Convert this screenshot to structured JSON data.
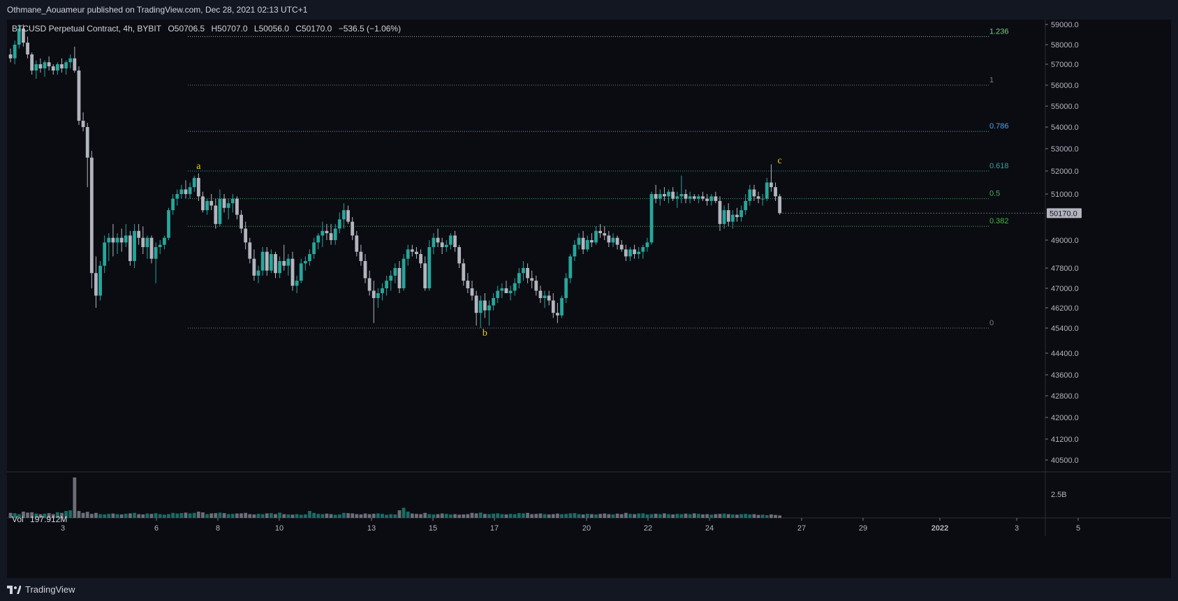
{
  "header": {
    "published": "Othmane_Aouameur published on TradingView.com, Dec 28, 2021 02:13 UTC+1"
  },
  "symbol": {
    "name": "BTCUSD Perpetual Contract, 4h, BYBIT",
    "open": "O50706.5",
    "high": "H50707.0",
    "low": "L50056.0",
    "close": "C50170.0",
    "change": "−536.5 (−1.06%)"
  },
  "volume_panel": {
    "label": "Vol",
    "value": "197.912M",
    "axis_label": "2.5B"
  },
  "footer": {
    "brand": "TradingView"
  },
  "colors": {
    "background": "#0b0c12",
    "up_candle": "#26a69a",
    "down_candle": "#b2b5be",
    "wave_label": "#f5d400",
    "fib_0618": "#26a69a",
    "fib_05": "#4caf50",
    "fib_0786": "#42a5f5",
    "fib_1236": "#81c784",
    "fib_neutral": "#787b86",
    "price_tag_bg": "#b2b5be"
  },
  "chart_data": {
    "type": "candlestick",
    "title": "BTCUSD Perpetual Contract, 4h, BYBIT",
    "y_axis": {
      "ticks": [
        "59000.0",
        "58000.0",
        "57000.0",
        "56000.0",
        "55000.0",
        "54000.0",
        "53000.0",
        "52000.0",
        "51000.0",
        "49000.0",
        "47800.0",
        "47000.0",
        "46200.0",
        "45400.0",
        "44400.0",
        "43600.0",
        "42800.0",
        "42000.0",
        "41200.0",
        "40500.0"
      ],
      "last_price": "50170.0"
    },
    "x_axis": {
      "ticks": [
        "3",
        "6",
        "8",
        "10",
        "13",
        "15",
        "17",
        "20",
        "22",
        "24",
        "27",
        "29",
        "2022",
        "3",
        "5"
      ]
    },
    "fib_levels": [
      {
        "label": "1.236",
        "price": 58400
      },
      {
        "label": "1",
        "price": 56000
      },
      {
        "label": "0.786",
        "price": 53800
      },
      {
        "label": "0.618",
        "price": 52000
      },
      {
        "label": "0.5",
        "price": 50800
      },
      {
        "label": "0.382",
        "price": 49600
      },
      {
        "label": "0",
        "price": 45400
      }
    ],
    "wave_labels": [
      {
        "label": "a",
        "bar": 44,
        "price": 52100
      },
      {
        "label": "b",
        "bar": 111,
        "price": 45100
      },
      {
        "label": "c",
        "bar": 180,
        "price": 52350
      }
    ],
    "candles": [
      [
        57500,
        57800,
        57100,
        57300
      ],
      [
        57300,
        58200,
        57000,
        58000
      ],
      [
        58000,
        59000,
        57800,
        58800
      ],
      [
        58800,
        59000,
        57900,
        58100
      ],
      [
        58100,
        58400,
        57300,
        57500
      ],
      [
        57500,
        57600,
        56500,
        56700
      ],
      [
        56700,
        57200,
        56300,
        57000
      ],
      [
        57000,
        57300,
        56600,
        56800
      ],
      [
        56800,
        57200,
        56400,
        57100
      ],
      [
        57100,
        57400,
        56700,
        56900
      ],
      [
        56900,
        57000,
        56500,
        56700
      ],
      [
        56700,
        57100,
        56500,
        57000
      ],
      [
        57000,
        57300,
        56600,
        56800
      ],
      [
        56800,
        57200,
        56500,
        57100
      ],
      [
        57100,
        57500,
        56800,
        57300
      ],
      [
        57300,
        57900,
        56600,
        56700
      ],
      [
        56700,
        56900,
        54100,
        54300
      ],
      [
        54300,
        54700,
        53800,
        54000
      ],
      [
        54000,
        54200,
        51300,
        52600
      ],
      [
        52600,
        52900,
        47000,
        47600
      ],
      [
        47600,
        48300,
        46200,
        46700
      ],
      [
        46700,
        48100,
        46500,
        47900
      ],
      [
        47900,
        49200,
        47600,
        48900
      ],
      [
        48900,
        49300,
        48100,
        49100
      ],
      [
        49100,
        49700,
        48300,
        48900
      ],
      [
        48900,
        49300,
        48400,
        49100
      ],
      [
        49100,
        49500,
        48500,
        48900
      ],
      [
        48900,
        49700,
        48700,
        49200
      ],
      [
        49200,
        49400,
        47900,
        48100
      ],
      [
        48100,
        49700,
        47800,
        49400
      ],
      [
        49400,
        49700,
        48800,
        49100
      ],
      [
        49100,
        49600,
        48400,
        48700
      ],
      [
        48700,
        49200,
        48200,
        49100
      ],
      [
        49100,
        49200,
        48000,
        48200
      ],
      [
        48200,
        48900,
        47200,
        48700
      ],
      [
        48700,
        49000,
        48400,
        48800
      ],
      [
        48800,
        49200,
        48600,
        49100
      ],
      [
        49100,
        50400,
        49000,
        50300
      ],
      [
        50300,
        51000,
        50100,
        50800
      ],
      [
        50800,
        51200,
        50500,
        51000
      ],
      [
        51000,
        51400,
        50800,
        51200
      ],
      [
        51200,
        51600,
        50800,
        51000
      ],
      [
        51000,
        51500,
        50800,
        51300
      ],
      [
        51300,
        51800,
        51100,
        51700
      ],
      [
        51700,
        51900,
        50700,
        50900
      ],
      [
        50900,
        51100,
        50200,
        50300
      ],
      [
        50300,
        50800,
        50100,
        50700
      ],
      [
        50700,
        51000,
        50300,
        50500
      ],
      [
        50500,
        50800,
        49500,
        49700
      ],
      [
        49700,
        51200,
        49600,
        50800
      ],
      [
        50800,
        51000,
        50200,
        50400
      ],
      [
        50400,
        50800,
        49900,
        50600
      ],
      [
        50600,
        51000,
        50200,
        50800
      ],
      [
        50800,
        50900,
        49900,
        50100
      ],
      [
        50100,
        50300,
        49300,
        49500
      ],
      [
        49500,
        49800,
        48600,
        48900
      ],
      [
        48900,
        49100,
        48000,
        48200
      ],
      [
        48200,
        48600,
        47300,
        47500
      ],
      [
        47500,
        47900,
        47200,
        47700
      ],
      [
        47700,
        48700,
        47500,
        48500
      ],
      [
        48500,
        48700,
        47500,
        47700
      ],
      [
        47700,
        48600,
        47600,
        48400
      ],
      [
        48400,
        48500,
        47400,
        47600
      ],
      [
        47600,
        48300,
        47400,
        48100
      ],
      [
        48100,
        48800,
        47700,
        47900
      ],
      [
        47900,
        48400,
        47500,
        48200
      ],
      [
        48200,
        48500,
        46900,
        47100
      ],
      [
        47100,
        47500,
        46800,
        47300
      ],
      [
        47300,
        48200,
        47200,
        48000
      ],
      [
        48000,
        48300,
        47700,
        48100
      ],
      [
        48100,
        48600,
        47900,
        48400
      ],
      [
        48400,
        49100,
        48200,
        48900
      ],
      [
        48900,
        49300,
        48600,
        49200
      ],
      [
        49200,
        49800,
        48700,
        49400
      ],
      [
        49400,
        49700,
        49000,
        49300
      ],
      [
        49300,
        49700,
        48800,
        49000
      ],
      [
        49000,
        49700,
        48800,
        49500
      ],
      [
        49500,
        50200,
        49300,
        49900
      ],
      [
        49900,
        50600,
        49500,
        50300
      ],
      [
        50300,
        50500,
        49700,
        49800
      ],
      [
        49800,
        50000,
        49000,
        49200
      ],
      [
        49200,
        49400,
        48300,
        48500
      ],
      [
        48500,
        48800,
        47900,
        48100
      ],
      [
        48100,
        48400,
        47200,
        47400
      ],
      [
        47400,
        47700,
        46700,
        46900
      ],
      [
        46900,
        47300,
        45600,
        46600
      ],
      [
        46600,
        47000,
        46200,
        46800
      ],
      [
        46800,
        47200,
        46500,
        47000
      ],
      [
        47000,
        47500,
        46700,
        47300
      ],
      [
        47300,
        47700,
        46900,
        47500
      ],
      [
        47500,
        48000,
        47200,
        47800
      ],
      [
        47800,
        48100,
        46800,
        47000
      ],
      [
        47000,
        48400,
        46900,
        48200
      ],
      [
        48200,
        48800,
        47900,
        48600
      ],
      [
        48600,
        48800,
        48300,
        48500
      ],
      [
        48500,
        48700,
        48200,
        48400
      ],
      [
        48400,
        48600,
        47800,
        48000
      ],
      [
        48000,
        48300,
        46900,
        47000
      ],
      [
        47000,
        49000,
        46900,
        48700
      ],
      [
        48700,
        49300,
        48400,
        49100
      ],
      [
        49100,
        49500,
        48700,
        48900
      ],
      [
        48900,
        49100,
        48400,
        48700
      ],
      [
        48700,
        49000,
        48500,
        48800
      ],
      [
        48800,
        49300,
        48600,
        49200
      ],
      [
        49200,
        49400,
        48500,
        48700
      ],
      [
        48700,
        48800,
        47800,
        48000
      ],
      [
        48000,
        48200,
        47100,
        47300
      ],
      [
        47300,
        47600,
        46800,
        47000
      ],
      [
        47000,
        47300,
        46500,
        46700
      ],
      [
        46700,
        46900,
        45500,
        46000
      ],
      [
        46000,
        46700,
        45400,
        46500
      ],
      [
        46500,
        46800,
        45800,
        46100
      ],
      [
        46100,
        46500,
        45500,
        46300
      ],
      [
        46300,
        46800,
        46100,
        46600
      ],
      [
        46600,
        47100,
        46400,
        46900
      ],
      [
        46900,
        47200,
        46600,
        47000
      ],
      [
        47000,
        47300,
        46800,
        46800
      ],
      [
        46800,
        47100,
        46500,
        46900
      ],
      [
        46900,
        47400,
        46700,
        47200
      ],
      [
        47200,
        47800,
        47000,
        47600
      ],
      [
        47600,
        48100,
        47300,
        47800
      ],
      [
        47800,
        48000,
        47200,
        47400
      ],
      [
        47400,
        47700,
        47000,
        47300
      ],
      [
        47300,
        47500,
        46700,
        46900
      ],
      [
        46900,
        47100,
        46400,
        46600
      ],
      [
        46600,
        46900,
        46200,
        46700
      ],
      [
        46700,
        46900,
        46300,
        46500
      ],
      [
        46500,
        46800,
        45800,
        46000
      ],
      [
        46000,
        46400,
        45600,
        45900
      ],
      [
        45900,
        46700,
        45800,
        46600
      ],
      [
        46600,
        47600,
        46400,
        47400
      ],
      [
        47400,
        48400,
        47200,
        48300
      ],
      [
        48300,
        49000,
        48100,
        48800
      ],
      [
        48800,
        49300,
        48600,
        49100
      ],
      [
        49100,
        49400,
        48400,
        48600
      ],
      [
        48600,
        49200,
        48500,
        49000
      ],
      [
        49000,
        49300,
        48700,
        48900
      ],
      [
        48900,
        49600,
        48800,
        49400
      ],
      [
        49400,
        49700,
        49100,
        49300
      ],
      [
        49300,
        49600,
        49000,
        49200
      ],
      [
        49200,
        49400,
        48700,
        48900
      ],
      [
        48900,
        49300,
        48700,
        49100
      ],
      [
        49100,
        49200,
        48600,
        48800
      ],
      [
        48800,
        49000,
        48500,
        48600
      ],
      [
        48600,
        48800,
        48100,
        48300
      ],
      [
        48300,
        48700,
        48100,
        48600
      ],
      [
        48600,
        48800,
        48200,
        48400
      ],
      [
        48400,
        48700,
        48200,
        48500
      ],
      [
        48500,
        48800,
        48200,
        48700
      ],
      [
        48700,
        49100,
        48500,
        48900
      ],
      [
        48900,
        51100,
        48800,
        51000
      ],
      [
        51000,
        51400,
        50600,
        50800
      ],
      [
        50800,
        51200,
        50500,
        51000
      ],
      [
        51000,
        51300,
        50700,
        50900
      ],
      [
        50900,
        51200,
        50600,
        51100
      ],
      [
        51100,
        51300,
        50700,
        50800
      ],
      [
        50800,
        51100,
        50400,
        50900
      ],
      [
        50900,
        51800,
        50600,
        51000
      ],
      [
        51000,
        51200,
        50600,
        50800
      ],
      [
        50800,
        51100,
        50600,
        50900
      ],
      [
        50900,
        51000,
        50700,
        50800
      ],
      [
        50800,
        51000,
        50600,
        50900
      ],
      [
        50900,
        51100,
        50700,
        50800
      ],
      [
        50800,
        51000,
        50500,
        50700
      ],
      [
        50700,
        51000,
        50500,
        50900
      ],
      [
        50900,
        51100,
        50600,
        50700
      ],
      [
        50700,
        50900,
        49400,
        49700
      ],
      [
        49700,
        50500,
        49500,
        50300
      ],
      [
        50300,
        50600,
        49600,
        49800
      ],
      [
        49800,
        50300,
        49500,
        50100
      ],
      [
        50100,
        50400,
        49800,
        50000
      ],
      [
        50000,
        50500,
        49800,
        50300
      ],
      [
        50300,
        51000,
        50100,
        50700
      ],
      [
        50700,
        51400,
        50500,
        51200
      ],
      [
        51200,
        51400,
        50700,
        50900
      ],
      [
        50900,
        51100,
        50600,
        50800
      ],
      [
        50800,
        51000,
        50500,
        50800
      ],
      [
        50800,
        51700,
        50700,
        51500
      ],
      [
        51500,
        52300,
        51100,
        51300
      ],
      [
        51300,
        51500,
        50700,
        50900
      ],
      [
        50900,
        51000,
        50100,
        50170
      ]
    ],
    "volumes": [
      40,
      38,
      30,
      50,
      42,
      45,
      35,
      30,
      34,
      38,
      30,
      45,
      40,
      55,
      60,
      320,
      55,
      40,
      48,
      32,
      40,
      30,
      28,
      32,
      35,
      30,
      28,
      33,
      36,
      40,
      30,
      28,
      35,
      32,
      38,
      30,
      26,
      30,
      40,
      35,
      38,
      42,
      36,
      40,
      50,
      44,
      30,
      36,
      38,
      42,
      38,
      30,
      32,
      35,
      36,
      40,
      30,
      28,
      32,
      30,
      36,
      38,
      30,
      42,
      30,
      28,
      26,
      30,
      25,
      28,
      55,
      40,
      32,
      30,
      34,
      30,
      25,
      28,
      40,
      38,
      36,
      30,
      28,
      35,
      30,
      33,
      36,
      32,
      25,
      30,
      28,
      60,
      80,
      50,
      35,
      32,
      30,
      40,
      30,
      28,
      30,
      35,
      32,
      28,
      30,
      26,
      28,
      30,
      40,
      36,
      42,
      32,
      30,
      34,
      36,
      30,
      28,
      32,
      30,
      38,
      36,
      40,
      30,
      32,
      35,
      30,
      28,
      30,
      34,
      30,
      32,
      36,
      38,
      30,
      28,
      33,
      30,
      28,
      32,
      35,
      30,
      28,
      34,
      30,
      40,
      32,
      30,
      35,
      36,
      28,
      30,
      33,
      30,
      36,
      30,
      28,
      32,
      30,
      34,
      30,
      36,
      32,
      28,
      30,
      26,
      30,
      32,
      34,
      30,
      28,
      26,
      30,
      32,
      28,
      30,
      24,
      26,
      22,
      28,
      24,
      20
    ]
  }
}
